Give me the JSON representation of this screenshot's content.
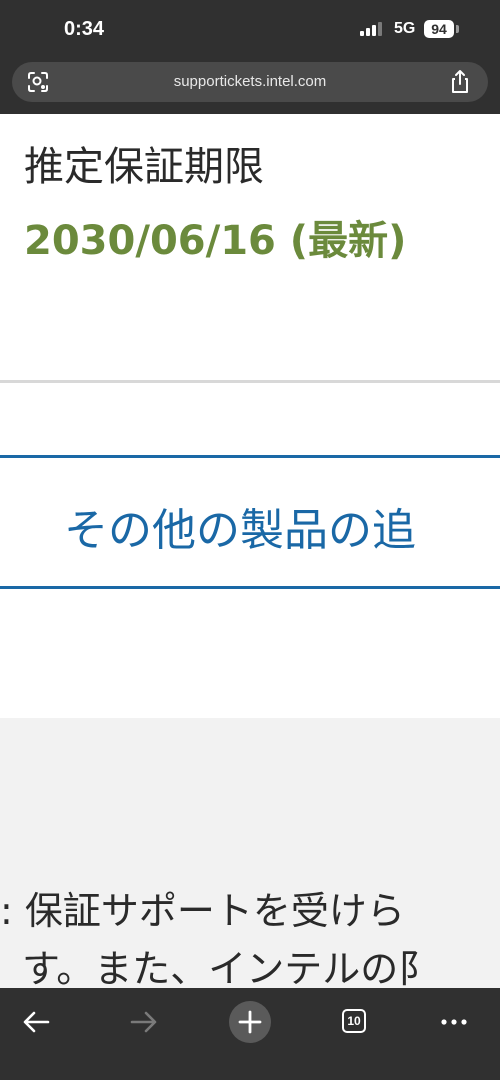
{
  "status_bar": {
    "time": "0:34",
    "network": "5G",
    "battery": "94"
  },
  "browser": {
    "url": "supportickets.intel.com",
    "tab_count": "10"
  },
  "content": {
    "warranty_label": "推定保証期限",
    "warranty_date": "2030/06/16 (最新)",
    "add_products_label": "その他の製品の追",
    "footer_line_1": ": 保証サポートを受けら",
    "footer_line_2": "す。また、インテルの阝"
  },
  "colors": {
    "date_green": "#6b8a3c",
    "link_blue": "#1a68a6",
    "chrome_dark": "#303030"
  }
}
